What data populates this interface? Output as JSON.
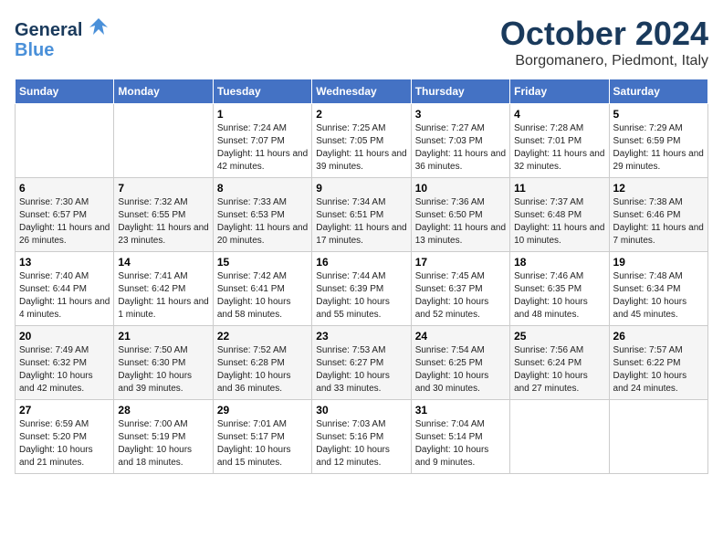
{
  "header": {
    "logo_line1": "General",
    "logo_line2": "Blue",
    "month": "October 2024",
    "location": "Borgomanero, Piedmont, Italy"
  },
  "weekdays": [
    "Sunday",
    "Monday",
    "Tuesday",
    "Wednesday",
    "Thursday",
    "Friday",
    "Saturday"
  ],
  "weeks": [
    [
      {
        "day": "",
        "info": ""
      },
      {
        "day": "",
        "info": ""
      },
      {
        "day": "1",
        "info": "Sunrise: 7:24 AM\nSunset: 7:07 PM\nDaylight: 11 hours and 42 minutes."
      },
      {
        "day": "2",
        "info": "Sunrise: 7:25 AM\nSunset: 7:05 PM\nDaylight: 11 hours and 39 minutes."
      },
      {
        "day": "3",
        "info": "Sunrise: 7:27 AM\nSunset: 7:03 PM\nDaylight: 11 hours and 36 minutes."
      },
      {
        "day": "4",
        "info": "Sunrise: 7:28 AM\nSunset: 7:01 PM\nDaylight: 11 hours and 32 minutes."
      },
      {
        "day": "5",
        "info": "Sunrise: 7:29 AM\nSunset: 6:59 PM\nDaylight: 11 hours and 29 minutes."
      }
    ],
    [
      {
        "day": "6",
        "info": "Sunrise: 7:30 AM\nSunset: 6:57 PM\nDaylight: 11 hours and 26 minutes."
      },
      {
        "day": "7",
        "info": "Sunrise: 7:32 AM\nSunset: 6:55 PM\nDaylight: 11 hours and 23 minutes."
      },
      {
        "day": "8",
        "info": "Sunrise: 7:33 AM\nSunset: 6:53 PM\nDaylight: 11 hours and 20 minutes."
      },
      {
        "day": "9",
        "info": "Sunrise: 7:34 AM\nSunset: 6:51 PM\nDaylight: 11 hours and 17 minutes."
      },
      {
        "day": "10",
        "info": "Sunrise: 7:36 AM\nSunset: 6:50 PM\nDaylight: 11 hours and 13 minutes."
      },
      {
        "day": "11",
        "info": "Sunrise: 7:37 AM\nSunset: 6:48 PM\nDaylight: 11 hours and 10 minutes."
      },
      {
        "day": "12",
        "info": "Sunrise: 7:38 AM\nSunset: 6:46 PM\nDaylight: 11 hours and 7 minutes."
      }
    ],
    [
      {
        "day": "13",
        "info": "Sunrise: 7:40 AM\nSunset: 6:44 PM\nDaylight: 11 hours and 4 minutes."
      },
      {
        "day": "14",
        "info": "Sunrise: 7:41 AM\nSunset: 6:42 PM\nDaylight: 11 hours and 1 minute."
      },
      {
        "day": "15",
        "info": "Sunrise: 7:42 AM\nSunset: 6:41 PM\nDaylight: 10 hours and 58 minutes."
      },
      {
        "day": "16",
        "info": "Sunrise: 7:44 AM\nSunset: 6:39 PM\nDaylight: 10 hours and 55 minutes."
      },
      {
        "day": "17",
        "info": "Sunrise: 7:45 AM\nSunset: 6:37 PM\nDaylight: 10 hours and 52 minutes."
      },
      {
        "day": "18",
        "info": "Sunrise: 7:46 AM\nSunset: 6:35 PM\nDaylight: 10 hours and 48 minutes."
      },
      {
        "day": "19",
        "info": "Sunrise: 7:48 AM\nSunset: 6:34 PM\nDaylight: 10 hours and 45 minutes."
      }
    ],
    [
      {
        "day": "20",
        "info": "Sunrise: 7:49 AM\nSunset: 6:32 PM\nDaylight: 10 hours and 42 minutes."
      },
      {
        "day": "21",
        "info": "Sunrise: 7:50 AM\nSunset: 6:30 PM\nDaylight: 10 hours and 39 minutes."
      },
      {
        "day": "22",
        "info": "Sunrise: 7:52 AM\nSunset: 6:28 PM\nDaylight: 10 hours and 36 minutes."
      },
      {
        "day": "23",
        "info": "Sunrise: 7:53 AM\nSunset: 6:27 PM\nDaylight: 10 hours and 33 minutes."
      },
      {
        "day": "24",
        "info": "Sunrise: 7:54 AM\nSunset: 6:25 PM\nDaylight: 10 hours and 30 minutes."
      },
      {
        "day": "25",
        "info": "Sunrise: 7:56 AM\nSunset: 6:24 PM\nDaylight: 10 hours and 27 minutes."
      },
      {
        "day": "26",
        "info": "Sunrise: 7:57 AM\nSunset: 6:22 PM\nDaylight: 10 hours and 24 minutes."
      }
    ],
    [
      {
        "day": "27",
        "info": "Sunrise: 6:59 AM\nSunset: 5:20 PM\nDaylight: 10 hours and 21 minutes."
      },
      {
        "day": "28",
        "info": "Sunrise: 7:00 AM\nSunset: 5:19 PM\nDaylight: 10 hours and 18 minutes."
      },
      {
        "day": "29",
        "info": "Sunrise: 7:01 AM\nSunset: 5:17 PM\nDaylight: 10 hours and 15 minutes."
      },
      {
        "day": "30",
        "info": "Sunrise: 7:03 AM\nSunset: 5:16 PM\nDaylight: 10 hours and 12 minutes."
      },
      {
        "day": "31",
        "info": "Sunrise: 7:04 AM\nSunset: 5:14 PM\nDaylight: 10 hours and 9 minutes."
      },
      {
        "day": "",
        "info": ""
      },
      {
        "day": "",
        "info": ""
      }
    ]
  ]
}
